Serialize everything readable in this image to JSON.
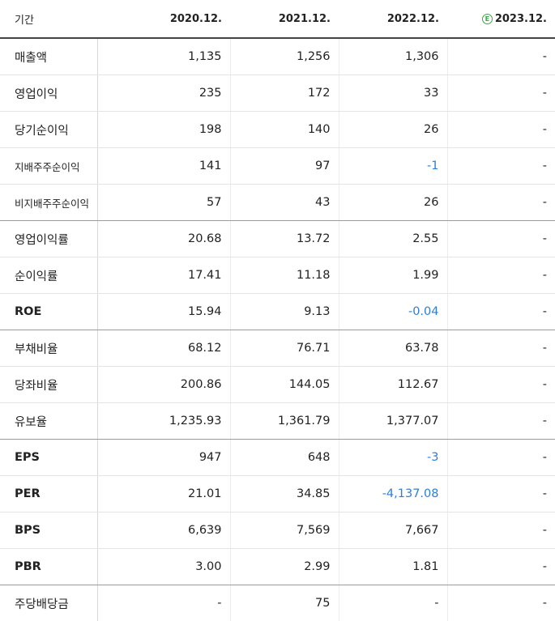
{
  "header": {
    "period_label": "기간",
    "columns": [
      "2020.12.",
      "2021.12.",
      "2022.12.",
      "2023.12."
    ],
    "estimate_mark": "E",
    "estimate_column": 3
  },
  "colors": {
    "negative": "#2c7fd6",
    "estimate": "#3aa64a"
  },
  "rows": [
    {
      "label": "매출액",
      "values": [
        "1,135",
        "1,256",
        "1,306",
        "-"
      ]
    },
    {
      "label": "영업이익",
      "values": [
        "235",
        "172",
        "33",
        "-"
      ]
    },
    {
      "label": "당기순이익",
      "values": [
        "198",
        "140",
        "26",
        "-"
      ]
    },
    {
      "label": "지배주주순이익",
      "values": [
        "141",
        "97",
        "-1",
        "-"
      ]
    },
    {
      "label": "비지배주주순이익",
      "values": [
        "57",
        "43",
        "26",
        "-"
      ]
    },
    {
      "label": "영업이익률",
      "values": [
        "20.68",
        "13.72",
        "2.55",
        "-"
      ]
    },
    {
      "label": "순이익률",
      "values": [
        "17.41",
        "11.18",
        "1.99",
        "-"
      ]
    },
    {
      "label": "ROE",
      "values": [
        "15.94",
        "9.13",
        "-0.04",
        "-"
      ]
    },
    {
      "label": "부채비율",
      "values": [
        "68.12",
        "76.71",
        "63.78",
        "-"
      ]
    },
    {
      "label": "당좌비율",
      "values": [
        "200.86",
        "144.05",
        "112.67",
        "-"
      ]
    },
    {
      "label": "유보율",
      "values": [
        "1,235.93",
        "1,361.79",
        "1,377.07",
        "-"
      ]
    },
    {
      "label": "EPS",
      "values": [
        "947",
        "648",
        "-3",
        "-"
      ]
    },
    {
      "label": "PER",
      "values": [
        "21.01",
        "34.85",
        "-4,137.08",
        "-"
      ]
    },
    {
      "label": "BPS",
      "values": [
        "6,639",
        "7,569",
        "7,667",
        "-"
      ]
    },
    {
      "label": "PBR",
      "values": [
        "3.00",
        "2.99",
        "1.81",
        "-"
      ]
    },
    {
      "label": "주당배당금",
      "values": [
        "-",
        "75",
        "-",
        "-"
      ]
    }
  ]
}
